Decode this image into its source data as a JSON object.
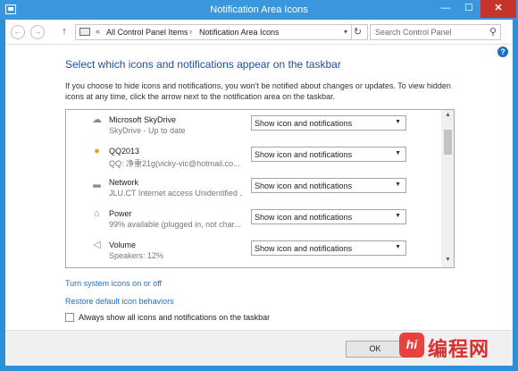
{
  "window": {
    "title": "Notification Area Icons",
    "minimize_glyph": "—",
    "maximize_glyph": "☐",
    "close_glyph": "✕"
  },
  "nav": {
    "back_glyph": "←",
    "forward_glyph": "→",
    "up_glyph": "↑",
    "breadcrumb_chevron": "«",
    "breadcrumb": [
      "All Control Panel Items",
      "Notification Area Icons"
    ],
    "separator": "›",
    "dropdown_glyph": "▾",
    "refresh_glyph": "↻",
    "search_placeholder": "Search Control Panel",
    "search_glyph": "⚲"
  },
  "help_glyph": "?",
  "heading": "Select which icons and notifications appear on the taskbar",
  "description": "If you choose to hide icons and notifications, you won't be notified about changes or updates. To view hidden icons at any time, click the arrow next to the notification area on the taskbar.",
  "items": [
    {
      "name": "Microsoft SkyDrive",
      "detail": "SkyDrive - Up to date",
      "behavior": "Show icon and notifications",
      "icon": "cloud-icon",
      "glyph": "☁"
    },
    {
      "name": "QQ2013",
      "detail": "QQ: 净重21g(vicky-vic@hotmail.co...",
      "behavior": "Show icon and notifications",
      "icon": "qq-penguin-icon",
      "glyph": "●"
    },
    {
      "name": "Network",
      "detail": "JLU.CT Internet access  Unidentified ...",
      "behavior": "Show icon and notifications",
      "icon": "network-signal-icon",
      "glyph": "▂"
    },
    {
      "name": "Power",
      "detail": "99% available (plugged in, not char...",
      "behavior": "Show icon and notifications",
      "icon": "power-plug-icon",
      "glyph": "⌂"
    },
    {
      "name": "Volume",
      "detail": "Speakers: 12%",
      "behavior": "Show icon and notifications",
      "icon": "speaker-icon",
      "glyph": "◁"
    }
  ],
  "dropdown_arrow": "▼",
  "scroll_up_glyph": "▲",
  "scroll_down_glyph": "▼",
  "links": {
    "system_icons": "Turn system icons on or off",
    "restore": "Restore default icon behaviors"
  },
  "checkbox_label": "Always show all icons and notifications on the taskbar",
  "checkbox_checked": false,
  "ok_label": "OK",
  "watermark": {
    "badge": "hi",
    "text": "编程网"
  },
  "colors": {
    "accent": "#3a97dd",
    "heading": "#1e4f9c",
    "link": "#1f6fc5",
    "close": "#c7332b"
  }
}
